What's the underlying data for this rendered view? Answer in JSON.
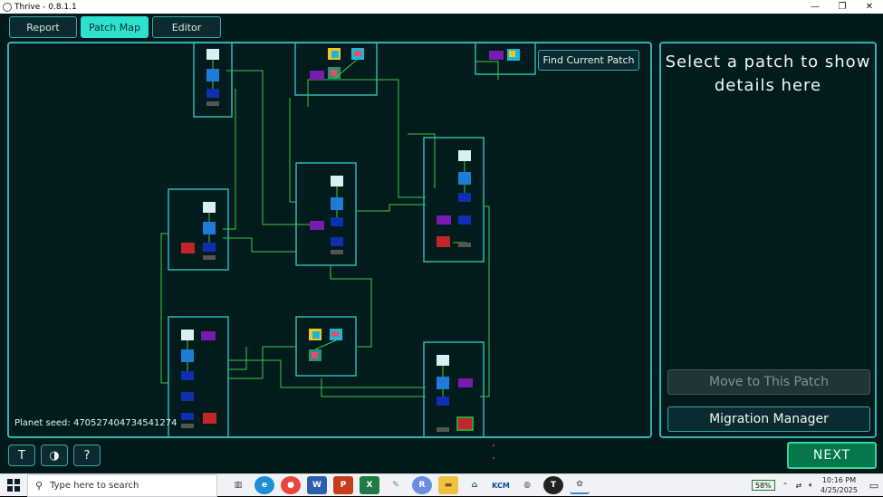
{
  "window": {
    "title": "Thrive - 0.8.1.1",
    "minimize": "—",
    "maximize": "❐",
    "close": "✕"
  },
  "tabs": [
    {
      "label": "Report"
    },
    {
      "label": "Patch Map"
    },
    {
      "label": "Editor"
    }
  ],
  "map": {
    "find_current_patch": "Find Current Patch",
    "planet_seed_label": "Planet seed:",
    "planet_seed_value": "470527404734541274"
  },
  "details": {
    "placeholder": "Select a patch to show details here",
    "move_button": "Move to This Patch",
    "migration_button": "Migration Manager"
  },
  "bottom": {
    "thriveopedia_icon": "T",
    "planet_icon": "◑",
    "help_icon": "?",
    "next": "NEXT"
  },
  "taskbar": {
    "search_placeholder": "Type here to search",
    "battery": "58%",
    "time": "10:16 PM",
    "date": "4/25/2025"
  },
  "colors": {
    "accent": "#2de0d0",
    "panel_border": "#2fb5ad",
    "link_green": "#3cc940",
    "next_bg": "#05774a"
  }
}
